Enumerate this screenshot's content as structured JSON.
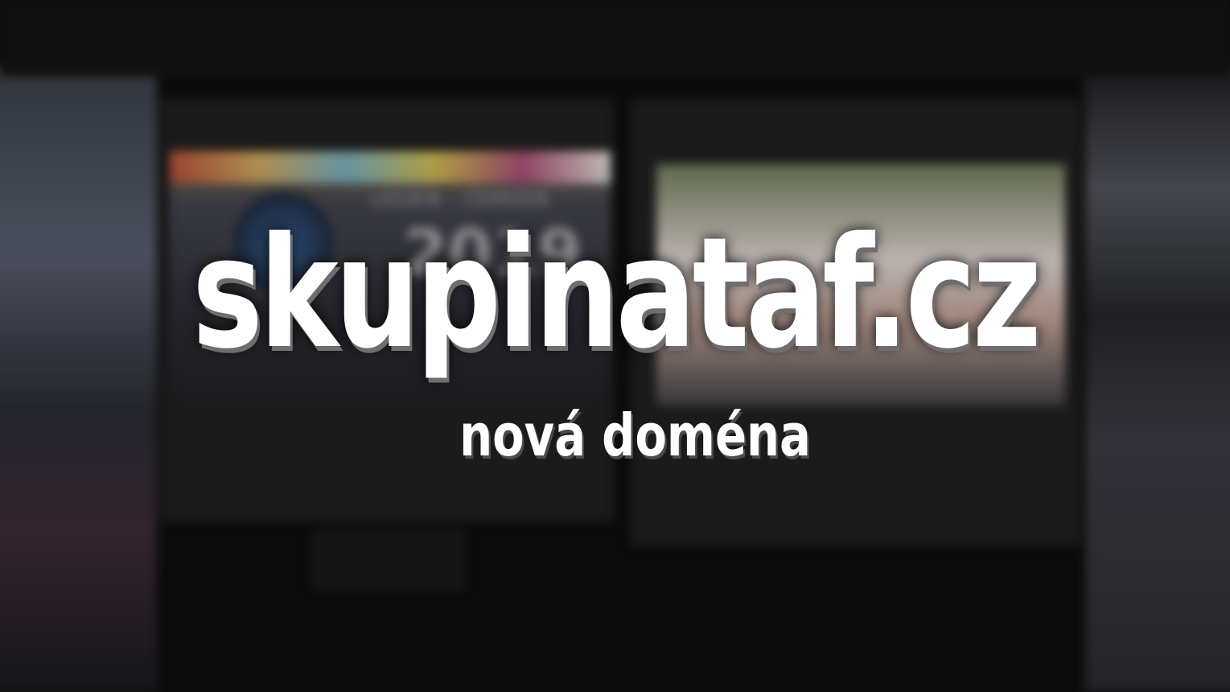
{
  "overlay": {
    "domain_title": "skupinataf.cz",
    "subtitle": "nová doména"
  },
  "background": {
    "window_title": "",
    "nav_items": [
      "",
      "",
      "",
      ""
    ],
    "left_panel": {
      "heading": "",
      "body": ""
    },
    "right_panel": {
      "heading": "",
      "heading_link": "",
      "body": ""
    },
    "left_thumb": {
      "caption_top": "LEDEN – ČERVEN",
      "caption_big": "2019"
    },
    "button_label": "",
    "section_heading": ""
  }
}
